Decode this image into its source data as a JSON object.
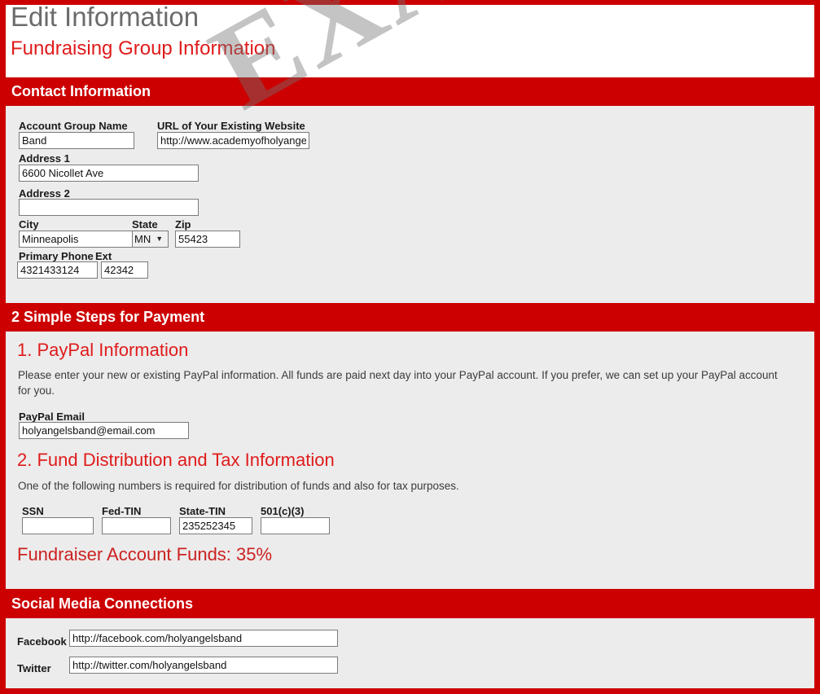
{
  "header": {
    "title": "Edit Information",
    "subtitle": "Fundraising Group Information"
  },
  "watermark": {
    "text": "EXAMPLE"
  },
  "colors": {
    "brand_red": "#cc0000",
    "accent_red": "#e01b1b",
    "panel_gray": "#ececec",
    "title_gray": "#6b6b6b"
  },
  "contact_section": {
    "heading": "Contact Information",
    "fields": {
      "account_group_name": {
        "label": "Account Group Name",
        "value": "Band",
        "placeholder": ""
      },
      "website_url": {
        "label": "URL of Your Existing Website",
        "value": "http://www.academyofholyangels.or",
        "placeholder": ""
      },
      "address1": {
        "label": "Address 1",
        "value": "6600 Nicollet Ave",
        "placeholder": ""
      },
      "address2": {
        "label": "Address 2",
        "value": "",
        "placeholder": ""
      },
      "city": {
        "label": "City",
        "value": "Minneapolis",
        "placeholder": ""
      },
      "state": {
        "label": "State",
        "value": "MN",
        "caret": "▼"
      },
      "zip": {
        "label": "Zip",
        "value": "55423",
        "placeholder": ""
      },
      "primary_phone": {
        "label": "Primary Phone",
        "value": "4321433124",
        "placeholder": ""
      },
      "ext": {
        "label": "Ext",
        "value": "42342",
        "placeholder": ""
      }
    }
  },
  "payment_section": {
    "heading": "2 Simple Steps for Payment",
    "step1": {
      "heading": "1. PayPal Information",
      "paragraph": "Please enter your new or existing PayPal information. All funds are paid next day into your PayPal account. If you prefer, we can set up your PayPal account for you.",
      "paypal_email": {
        "label": "PayPal Email",
        "value": "holyangelsband@email.com",
        "placeholder": ""
      }
    },
    "step2": {
      "heading": "2. Fund Distribution and Tax Information",
      "paragraph": "One of the following numbers is required for distribution of funds and also for tax purposes.",
      "fields": {
        "ssn": {
          "label": "SSN",
          "value": "",
          "placeholder": ""
        },
        "fed_tin": {
          "label": "Fed-TIN",
          "value": "",
          "placeholder": ""
        },
        "state_tin": {
          "label": "State-TIN",
          "value": "235252345",
          "placeholder": ""
        },
        "nonprofit_501c3": {
          "label": "501(c)(3)",
          "value": "",
          "placeholder": ""
        }
      }
    },
    "funds_line": "Fundraiser Account Funds: 35%"
  },
  "social_section": {
    "heading": "Social Media Connections",
    "facebook": {
      "label": "Facebook",
      "value": "http://facebook.com/holyangelsband",
      "placeholder": ""
    },
    "twitter": {
      "label": "Twitter",
      "value": "http://twitter.com/holyangelsband",
      "placeholder": ""
    }
  }
}
